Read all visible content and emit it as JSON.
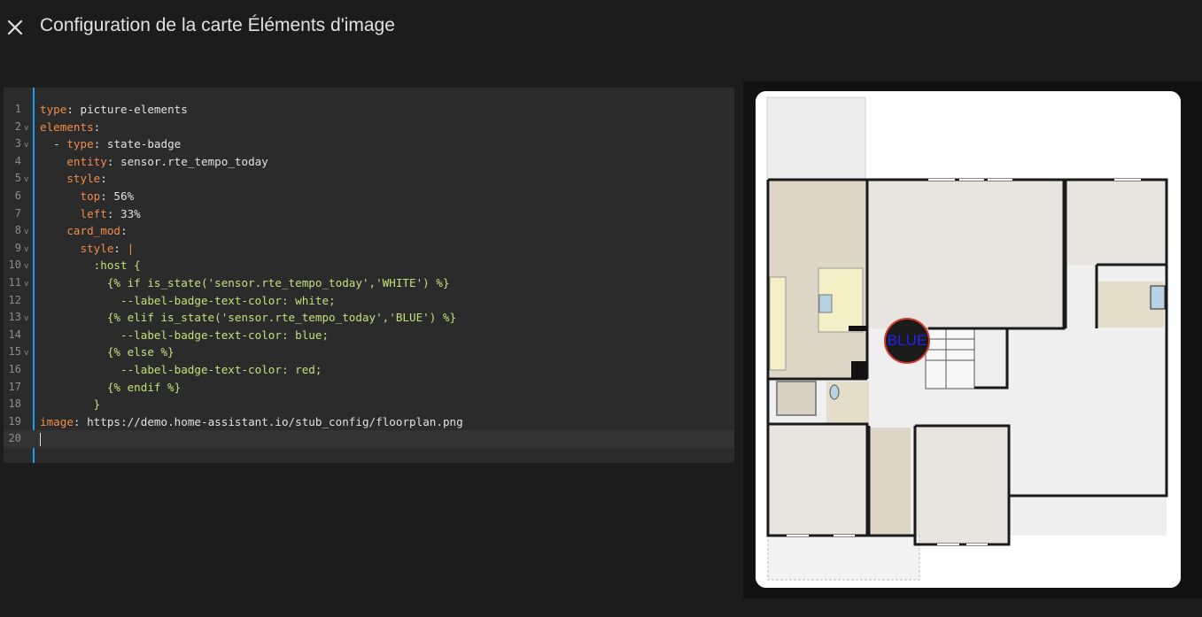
{
  "dialog": {
    "title": "Configuration de la carte Éléments d'image",
    "close_icon": "close-icon"
  },
  "editor": {
    "lines": [
      {
        "n": "1",
        "fold": false,
        "parts": [
          [
            "k",
            "type"
          ],
          [
            "p",
            ": "
          ],
          [
            "v",
            "picture-elements"
          ]
        ]
      },
      {
        "n": "2",
        "fold": true,
        "parts": [
          [
            "k",
            "elements"
          ],
          [
            "p",
            ":"
          ]
        ]
      },
      {
        "n": "3",
        "fold": true,
        "parts": [
          [
            "p",
            "  - "
          ],
          [
            "k",
            "type"
          ],
          [
            "p",
            ": "
          ],
          [
            "v",
            "state-badge"
          ]
        ]
      },
      {
        "n": "4",
        "fold": false,
        "parts": [
          [
            "p",
            "    "
          ],
          [
            "k",
            "entity"
          ],
          [
            "p",
            ": "
          ],
          [
            "v",
            "sensor.rte_tempo_today"
          ]
        ]
      },
      {
        "n": "5",
        "fold": true,
        "parts": [
          [
            "p",
            "    "
          ],
          [
            "k",
            "style"
          ],
          [
            "p",
            ":"
          ]
        ]
      },
      {
        "n": "6",
        "fold": false,
        "parts": [
          [
            "p",
            "      "
          ],
          [
            "k",
            "top"
          ],
          [
            "p",
            ": "
          ],
          [
            "v",
            "56%"
          ]
        ]
      },
      {
        "n": "7",
        "fold": false,
        "parts": [
          [
            "p",
            "      "
          ],
          [
            "k",
            "left"
          ],
          [
            "p",
            ": "
          ],
          [
            "v",
            "33%"
          ]
        ]
      },
      {
        "n": "8",
        "fold": true,
        "parts": [
          [
            "p",
            "    "
          ],
          [
            "k",
            "card_mod"
          ],
          [
            "p",
            ":"
          ]
        ]
      },
      {
        "n": "9",
        "fold": true,
        "parts": [
          [
            "p",
            "      "
          ],
          [
            "k",
            "style"
          ],
          [
            "p",
            ": "
          ],
          [
            "k",
            "|"
          ]
        ]
      },
      {
        "n": "10",
        "fold": true,
        "parts": [
          [
            "s",
            "        :host {"
          ]
        ]
      },
      {
        "n": "11",
        "fold": true,
        "parts": [
          [
            "s",
            "          {% if is_state('sensor.rte_tempo_today','WHITE') %}"
          ]
        ]
      },
      {
        "n": "12",
        "fold": false,
        "parts": [
          [
            "s",
            "            --label-badge-text-color: white;"
          ]
        ]
      },
      {
        "n": "13",
        "fold": true,
        "parts": [
          [
            "s",
            "          {% elif is_state('sensor.rte_tempo_today','BLUE') %}"
          ]
        ]
      },
      {
        "n": "14",
        "fold": false,
        "parts": [
          [
            "s",
            "            --label-badge-text-color: blue;"
          ]
        ]
      },
      {
        "n": "15",
        "fold": true,
        "parts": [
          [
            "s",
            "          {% else %}"
          ]
        ]
      },
      {
        "n": "16",
        "fold": false,
        "parts": [
          [
            "s",
            "            --label-badge-text-color: red;"
          ]
        ]
      },
      {
        "n": "17",
        "fold": false,
        "parts": [
          [
            "s",
            "          {% endif %}"
          ]
        ]
      },
      {
        "n": "18",
        "fold": false,
        "parts": [
          [
            "s",
            "        }"
          ]
        ]
      },
      {
        "n": "19",
        "fold": false,
        "parts": [
          [
            "k",
            "image"
          ],
          [
            "p",
            ": "
          ],
          [
            "v",
            "https://demo.home-assistant.io/stub_config/floorplan.png"
          ]
        ]
      },
      {
        "n": "20",
        "fold": false,
        "active": true,
        "parts": []
      }
    ],
    "fold_glyph": "v",
    "colors": {
      "key": "#f08d49",
      "string": "#c5e07a",
      "text": "#e1e1e1",
      "gutter": "#1e9be9"
    }
  },
  "preview": {
    "badge_text": "BLUE",
    "badge_text_color": "#2222ee",
    "floorplan_icon": "floorplan-image"
  }
}
